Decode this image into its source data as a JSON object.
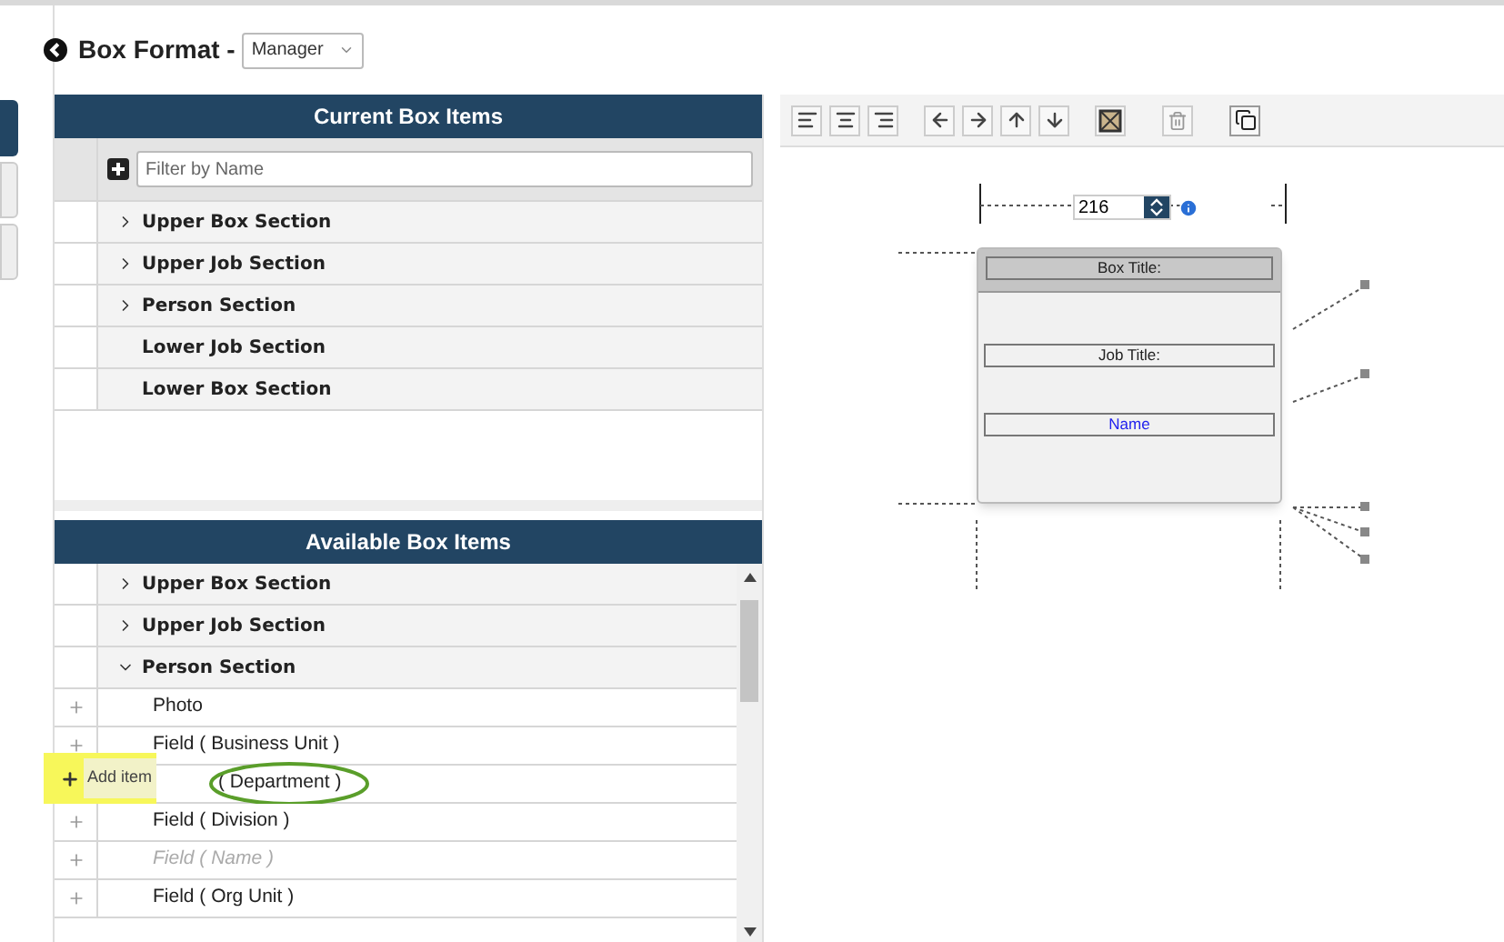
{
  "header": {
    "title": "Box Format -",
    "dropdown": "Manager"
  },
  "side_tabs": [
    {
      "selected": true
    },
    {
      "selected": false
    },
    {
      "selected": false
    }
  ],
  "current": {
    "title": "Current Box Items",
    "filter_placeholder": "Filter by Name",
    "rows": [
      {
        "label": "Upper Box Section",
        "kind": "group",
        "expanded": false
      },
      {
        "label": "Upper Job Section",
        "kind": "group",
        "expanded": false
      },
      {
        "label": "Person Section",
        "kind": "group",
        "expanded": false
      },
      {
        "label": "Lower Job Section",
        "kind": "plain"
      },
      {
        "label": "Lower Box Section",
        "kind": "plain"
      }
    ]
  },
  "available": {
    "title": "Available Box Items",
    "rows": [
      {
        "label": "Upper Box Section",
        "kind": "group",
        "expanded": false
      },
      {
        "label": "Upper Job Section",
        "kind": "group",
        "expanded": false
      },
      {
        "label": "Person Section",
        "kind": "group",
        "expanded": true
      },
      {
        "label": "Photo",
        "kind": "field",
        "disabled": false
      },
      {
        "label": "Field  ( Business Unit )",
        "kind": "field",
        "disabled": false
      },
      {
        "label": "( Department )",
        "kind": "field",
        "disabled": false,
        "tooltip": "Add item",
        "circled": true
      },
      {
        "label": "Field  ( Division )",
        "kind": "field",
        "disabled": false
      },
      {
        "label": "Field  ( Name )",
        "kind": "field",
        "disabled": true
      },
      {
        "label": "Field  ( Org Unit )",
        "kind": "field",
        "disabled": false
      }
    ]
  },
  "canvas": {
    "width_value": "216",
    "box_items": [
      {
        "label": "Box Title:",
        "kind": "title"
      },
      {
        "label": "Job Title:",
        "kind": "field"
      },
      {
        "label": "Name",
        "kind": "link"
      }
    ]
  }
}
